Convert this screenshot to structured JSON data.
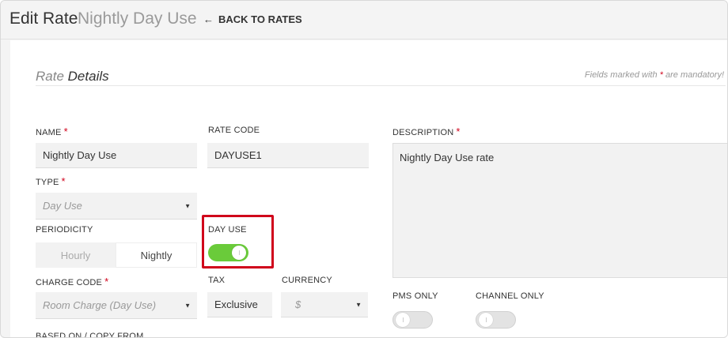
{
  "header": {
    "title": "Edit Rate",
    "subtitle": "Nightly Day Use",
    "back_icon": "left-arrow-icon",
    "back_label": "BACK TO RATES"
  },
  "section": {
    "title_light": "Rate",
    "title_dark": "Details",
    "note_before": "Fields marked with",
    "note_star": "*",
    "note_after": "are mandatory!"
  },
  "form": {
    "name": {
      "label": "NAME",
      "required": "*",
      "value": "Nightly Day Use"
    },
    "rate_code": {
      "label": "RATE CODE",
      "value": "DAYUSE1"
    },
    "description": {
      "label": "DESCRIPTION",
      "required": "*",
      "value": "Nightly Day Use rate"
    },
    "type": {
      "label": "TYPE",
      "required": "*",
      "value": "Day Use"
    },
    "periodicity": {
      "label": "PERIODICITY",
      "options": [
        "Hourly",
        "Nightly"
      ],
      "selected": "Nightly"
    },
    "day_use": {
      "label": "DAY USE",
      "on": true
    },
    "charge_code": {
      "label": "CHARGE CODE",
      "required": "*",
      "value": "Room Charge (Day Use)"
    },
    "tax": {
      "label": "TAX",
      "value": "Exclusive"
    },
    "currency": {
      "label": "CURRENCY",
      "value": "$"
    },
    "pms_only": {
      "label": "PMS ONLY",
      "on": false
    },
    "channel_only": {
      "label": "CHANNEL ONLY",
      "on": false
    },
    "based_on": {
      "label": "BASED ON / COPY FROM"
    }
  },
  "colors": {
    "toggle_on": "#6acb3a",
    "highlight": "#d0021b",
    "required_star": "#d0021b"
  }
}
